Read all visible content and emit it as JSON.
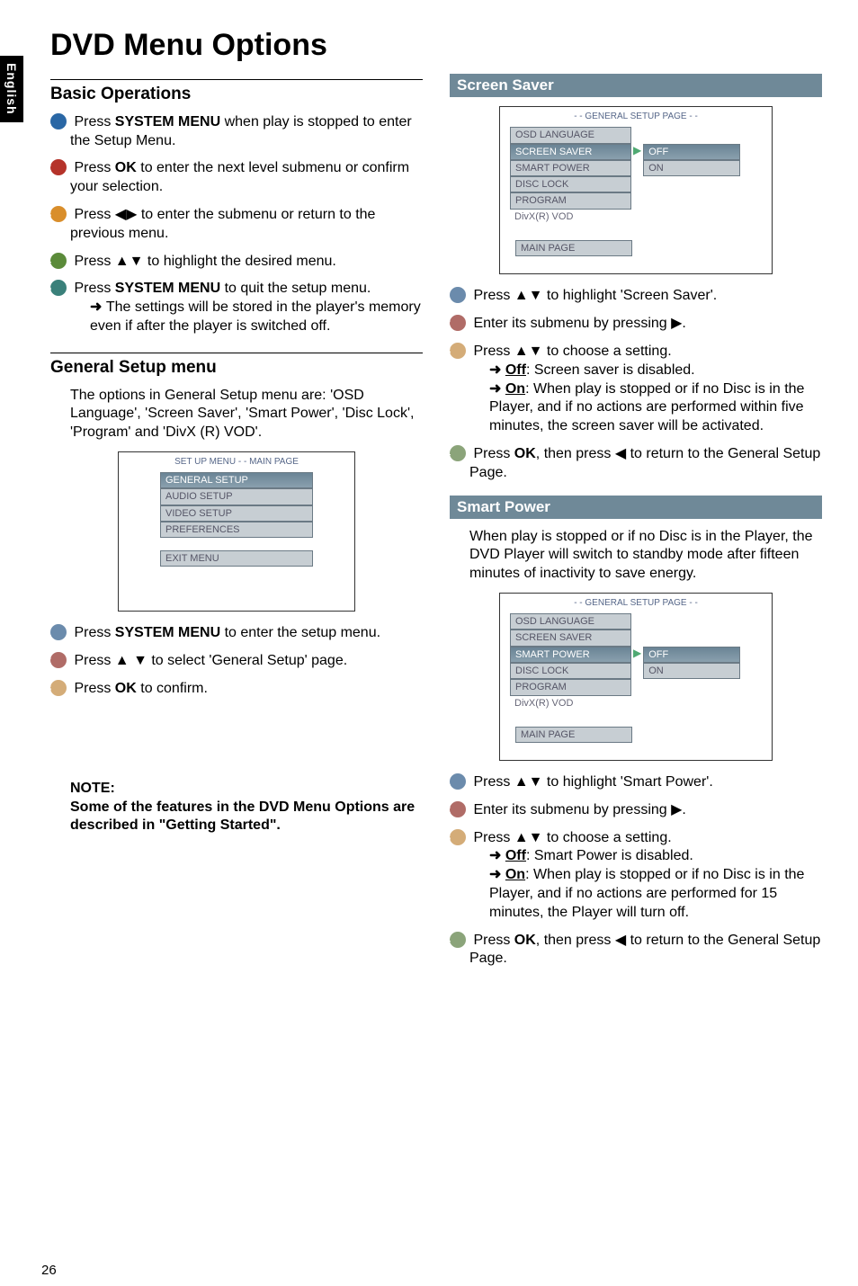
{
  "lang_tab": "English",
  "title": "DVD Menu Options",
  "page_number": "26",
  "left": {
    "basic_head": "Basic Operations",
    "s1a": "Press ",
    "s1b": "SYSTEM MENU",
    "s1c": " when play is stopped to enter the Setup Menu.",
    "s2a": "Press ",
    "s2b": "OK",
    "s2c": " to enter the next level submenu or confirm your selection.",
    "s3a": "Press ◀▶  to enter the submenu or return to the previous menu.",
    "s4a": "Press ▲▼ to highlight the desired menu.",
    "s5a": "Press ",
    "s5b": "SYSTEM MENU",
    "s5c": " to quit the setup menu.",
    "s5_sub": "The settings will be stored in the player's memory even if after the player is switched off.",
    "general_head": "General Setup menu",
    "general_body": "The options in General Setup menu are: 'OSD Language', 'Screen Saver', 'Smart Power', 'Disc Lock', 'Program' and 'DivX (R) VOD'.",
    "osd1_title": "SET UP MENU - - MAIN PAGE",
    "osd1_items": [
      "GENERAL SETUP",
      "AUDIO SETUP",
      "VIDEO SETUP",
      "PREFERENCES"
    ],
    "osd1_exit": "EXIT MENU",
    "g1a": "Press ",
    "g1b": "SYSTEM MENU",
    "g1c": " to enter the setup menu.",
    "g2": "Press ▲ ▼ to select 'General Setup' page.",
    "g3a": "Press ",
    "g3b": "OK",
    "g3c": " to confirm.",
    "note_head": "NOTE:",
    "note_body": "Some of the features in the DVD Menu Options are described in \"Getting Started\"."
  },
  "right": {
    "ss_head": "Screen Saver",
    "osd2_title": "- - GENERAL SETUP PAGE - -",
    "osd2_left": [
      "OSD LANGUAGE",
      "SCREEN SAVER",
      "SMART POWER",
      "DISC LOCK",
      "PROGRAM",
      "DivX(R) VOD"
    ],
    "osd2_sel_index": 1,
    "osd2_right": [
      "OFF",
      "ON"
    ],
    "osd2_right_sel": 0,
    "osd2_main": "MAIN PAGE",
    "ss1": "Press ▲▼ to highlight 'Screen Saver'.",
    "ss2": "Enter its submenu by pressing ▶.",
    "ss3": "Press ▲▼ to choose a setting.",
    "ss3_off_l": "Off",
    "ss3_off_t": ": Screen saver is disabled.",
    "ss3_on_l": "On",
    "ss3_on_t": ": When play is stopped or if no Disc is in the Player, and if no actions are performed within five minutes, the screen saver will be activated.",
    "ss4a": "Press ",
    "ss4b": "OK",
    "ss4c": ", then press ◀ to return to the General Setup Page.",
    "sp_head": "Smart Power",
    "sp_body": "When play is stopped or if no Disc is in the Player, the DVD Player will switch to standby mode after fifteen minutes of inactivity to save energy.",
    "osd3_title": "- - GENERAL SETUP PAGE - -",
    "osd3_left": [
      "OSD LANGUAGE",
      "SCREEN SAVER",
      "SMART POWER",
      "DISC LOCK",
      "PROGRAM",
      "DivX(R) VOD"
    ],
    "osd3_sel_index": 2,
    "osd3_right": [
      "OFF",
      "ON"
    ],
    "osd3_right_sel": 0,
    "osd3_main": "MAIN PAGE",
    "sp1": "Press ▲▼ to highlight 'Smart Power'.",
    "sp2": "Enter its submenu by pressing ▶.",
    "sp3": "Press ▲▼ to choose a setting.",
    "sp3_off_l": "Off",
    "sp3_off_t": ": Smart Power is disabled.",
    "sp3_on_l": "On",
    "sp3_on_t": ": When play is stopped or if no Disc is in the Player, and if no actions are performed for 15 minutes, the Player will turn off.",
    "sp4a": "Press ",
    "sp4b": "OK",
    "sp4c": ", then press ◀ to return to the General Setup Page."
  }
}
